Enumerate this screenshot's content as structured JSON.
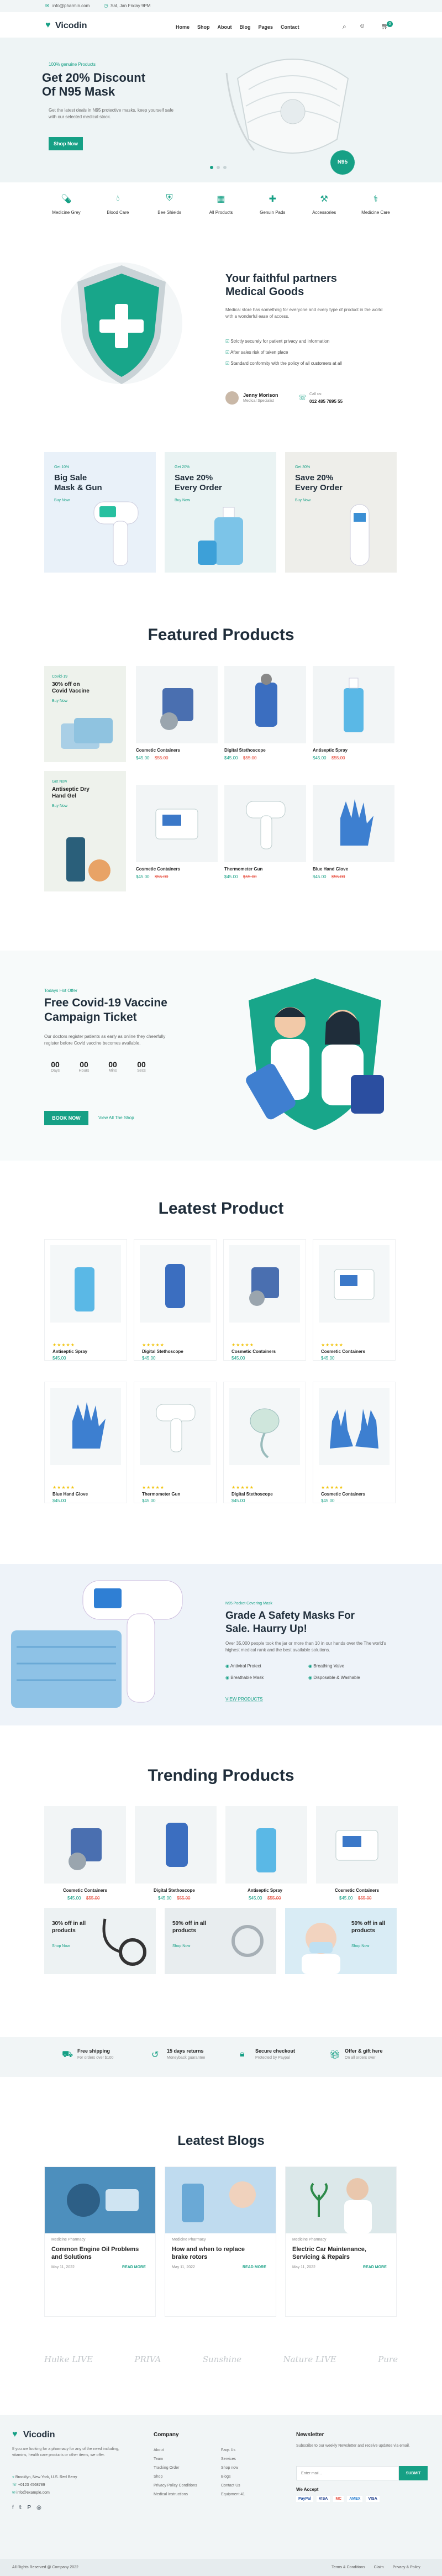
{
  "topbar": {
    "email": "info@pharmin.com",
    "hours": "Sat, Jan Friday 9PM"
  },
  "header": {
    "logo": "Vicodin",
    "nav": [
      "Home",
      "Shop",
      "About",
      "Blog",
      "Pages",
      "Contact"
    ],
    "cart_count": "0"
  },
  "hero": {
    "eyebrow": "100% genuine Products",
    "title_line1": "Get 20% Discount",
    "title_line2": "Of N95 Mask",
    "text": "Get the latest deals in N95 protective masks, keep yourself safe with our selected medical stock.",
    "button": "Shop Now",
    "badge": "N95"
  },
  "categories": [
    {
      "label": "Medicine Grey",
      "icon": "pill-icon"
    },
    {
      "label": "Blood Care",
      "icon": "blood-drop-icon"
    },
    {
      "label": "Bee Shields",
      "icon": "shield-icon"
    },
    {
      "label": "All Products",
      "icon": "grid-icon"
    },
    {
      "label": "Genuin Pads",
      "icon": "bandage-icon"
    },
    {
      "label": "Accessories",
      "icon": "tools-icon"
    },
    {
      "label": "Medicine Care",
      "icon": "capsule-icon"
    }
  ],
  "partners": {
    "title_line1": "Your faithful partners",
    "title_line2": "Medical Goods",
    "text": "Medical store has something for everyone and every type of product in the world with a wonderful ease of access.",
    "bullets": [
      "Strictly securely for patient privacy and information",
      "After sales risk of taken place",
      "Standard conformity with the policy of all customers at all"
    ],
    "person_name": "Jenny Morison",
    "person_role": "Medical Specialist",
    "phone_label": "Call us:",
    "phone": "012 485 7895 55"
  },
  "promo": [
    {
      "tag": "Get 10%",
      "title_line1": "Big Sale",
      "title_line2": "Mask & Gun",
      "link": "Buy Now"
    },
    {
      "tag": "Get 20%",
      "title_line1": "Save 20%",
      "title_line2": "Every Order",
      "link": "Buy Now"
    },
    {
      "tag": "Get 30%",
      "title_line1": "Save 20%",
      "title_line2": "Every Order",
      "link": "Buy Now"
    }
  ],
  "featured": {
    "title": "Featured Products",
    "side1": {
      "tag": "Covid-19",
      "title": "30% off on Covid Vaccine",
      "link": "Buy Now"
    },
    "side2": {
      "tag": "Get Now",
      "title": "Antiseptic Dry Hand Gel",
      "link": "Buy Now"
    },
    "products": [
      {
        "name": "Cosmetic Containers",
        "price": "$45.00",
        "old": "$55.00"
      },
      {
        "name": "Digital Stethoscope",
        "price": "$45.00",
        "old": "$55.00"
      },
      {
        "name": "Antiseptic Spray",
        "price": "$45.00",
        "old": "$55.00"
      },
      {
        "name": "Cosmetic Containers",
        "price": "$45.00",
        "old": "$55.00"
      },
      {
        "name": "Thermometer Gun",
        "price": "$45.00",
        "old": "$55.00"
      },
      {
        "name": "Blue Hand Glove",
        "price": "$45.00",
        "old": "$55.00"
      }
    ]
  },
  "vaccine": {
    "eyebrow": "Todays Hot Offer",
    "title_line1": "Free Covid-19 Vaccine",
    "title_line2": "Campaign Ticket",
    "text": "Our doctors register patients as early as online they cheerfully register before Covid vaccine becomes available.",
    "countdown": [
      {
        "value": "00",
        "label": "Days"
      },
      {
        "value": "00",
        "label": "Hours"
      },
      {
        "value": "00",
        "label": "Mins"
      },
      {
        "value": "00",
        "label": "Secs"
      }
    ],
    "button": "BOOK NOW",
    "link": "View All The Shop"
  },
  "leatest": {
    "title": "Leatest Product",
    "products": [
      {
        "name": "Antiseptic Spray",
        "price": "$45.00"
      },
      {
        "name": "Digital Stethoscope",
        "price": "$45.00"
      },
      {
        "name": "Cosmetic Containers",
        "price": "$45.00"
      },
      {
        "name": "Cosmetic Containers",
        "price": "$45.00"
      },
      {
        "name": "Blue Hand Glove",
        "price": "$45.00"
      },
      {
        "name": "Thermometer Gun",
        "price": "$45.00"
      },
      {
        "name": "Digital Stethoscope",
        "price": "$45.00"
      },
      {
        "name": "Cosmetic Containers",
        "price": "$45.00"
      }
    ]
  },
  "safety": {
    "eyebrow": "N95 Pocket Covering Mask",
    "title_line1": "Grade A Safety Masks For",
    "title_line2": "Sale. Haurry Up!",
    "text": "Over 35,000 people took the jar or more than 10 in our hands over the The world's highest medical rank and the best available solutions.",
    "features": [
      "Antiviral Protect",
      "Breathing Valve",
      "Breathable Mask",
      "Disposable & Washable"
    ],
    "link": "VIEW PRODUCTS"
  },
  "trending": {
    "title": "Trending Products",
    "products": [
      {
        "name": "Cosmetic Containers",
        "price": "$45.00",
        "old": "$55.00"
      },
      {
        "name": "Digital Stethoscope",
        "price": "$45.00",
        "old": "$55.00"
      },
      {
        "name": "Antiseptic Spray",
        "price": "$45.00",
        "old": "$55.00"
      },
      {
        "name": "Cosmetic Containers",
        "price": "$45.00",
        "old": "$55.00"
      }
    ],
    "banners": [
      {
        "title": "30% off in all products",
        "link": "Shop Now"
      },
      {
        "title": "50% off in all products",
        "link": "Shop Now"
      },
      {
        "title": "50% off in all products",
        "link": "Shop Now"
      }
    ]
  },
  "features": [
    {
      "title": "Free shipping",
      "text": "For orders over $100",
      "icon": "truck-icon"
    },
    {
      "title": "15 days returns",
      "text": "Moneyback guarantee",
      "icon": "return-icon"
    },
    {
      "title": "Secure checkout",
      "text": "Protected by Paypal",
      "icon": "lock-icon"
    },
    {
      "title": "Offer & gift here",
      "text": "On all orders over",
      "icon": "gift-icon"
    }
  ],
  "blogs": {
    "title": "Leatest Blogs",
    "items": [
      {
        "meta": "Medicine  Pharmacy",
        "title_line1": "Common Engine Oil Problems",
        "title_line2": "and Solutions",
        "date": "May 11, 2022",
        "link": "READ MORE"
      },
      {
        "meta": "Medicine  Pharmacy",
        "title_line1": "How and when to replace",
        "title_line2": "brake rotors",
        "date": "May 11, 2022",
        "link": "READ MORE"
      },
      {
        "meta": "Medicine  Pharmacy",
        "title_line1": "Electric Car Maintenance,",
        "title_line2": "Servicing & Repairs",
        "date": "May 11, 2022",
        "link": "READ MORE"
      }
    ]
  },
  "brands": [
    "Hulke LIVE",
    "PRIVA",
    "Sunshine",
    "Nature LIVE",
    "Pure"
  ],
  "footer": {
    "logo": "Vicodin",
    "about": "If you are looking for a pharmacy for any of the need including, vitamins, health care products or other items, we offer.",
    "address": "Brooklyn, New York, U.S. Red Berry",
    "phone": "+0123 4568789",
    "email": "info@example.com",
    "company_title": "Company",
    "company_col1": [
      "About",
      "Team",
      "Tracking Order",
      "Shop",
      "Privacy Policy Conditions",
      "Medical Instructions"
    ],
    "company_col2": [
      "Faqs Us",
      "Services",
      "Shop now",
      "Blogs",
      "Contact Us",
      "Equipment 41"
    ],
    "newsletter_title": "Newsletter",
    "newsletter_text": "Subscribe to our weekly Newsletter and receive updates via email.",
    "newsletter_placeholder": "Enter mail...",
    "newsletter_button": "SUBMIT",
    "accept": "We Accept",
    "payments": [
      "PayPal",
      "VISA",
      "MC",
      "AMEX",
      "VISA"
    ]
  },
  "bottom": {
    "copyright": "All Rights Reserved @ Company 2022",
    "links": [
      "Terms & Conditions",
      "Claim",
      "Privacy & Policy"
    ]
  },
  "colors": {
    "accent": "#16a085",
    "dark": "#1f2d3a",
    "sale": "#e74c3c"
  }
}
